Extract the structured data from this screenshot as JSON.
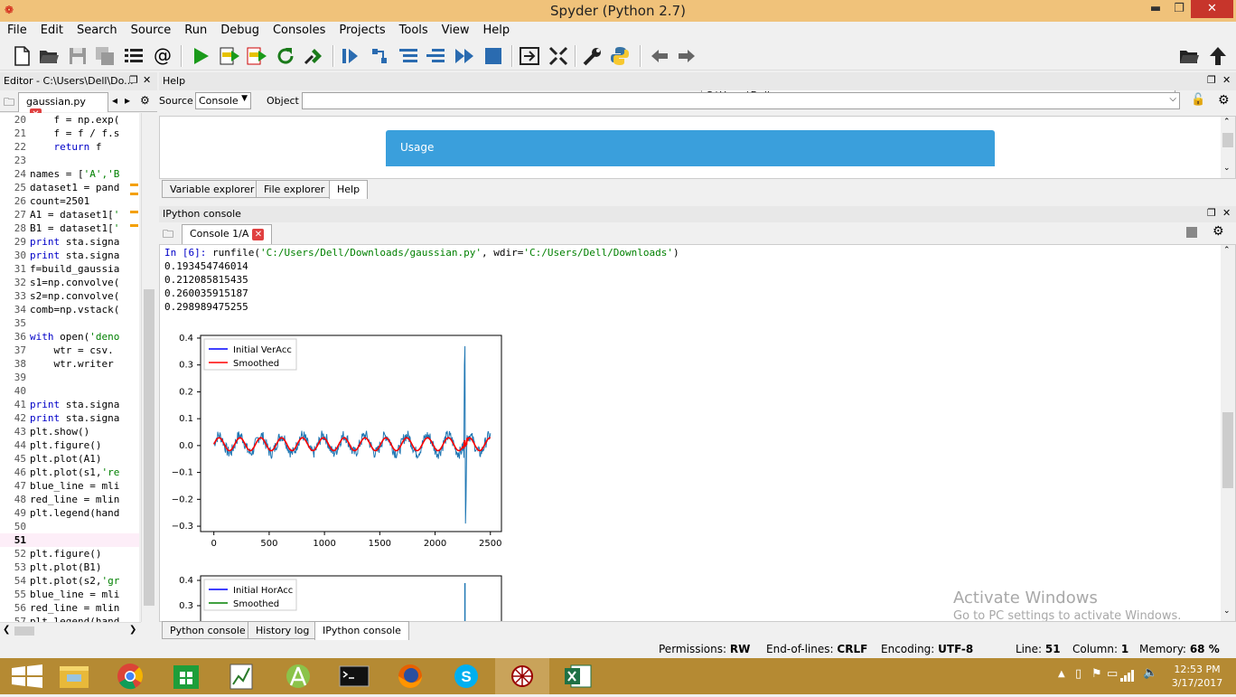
{
  "window": {
    "title": "Spyder (Python 2.7)",
    "min": "▬",
    "max": "❐",
    "close": "✕"
  },
  "menu": [
    "File",
    "Edit",
    "Search",
    "Source",
    "Run",
    "Debug",
    "Consoles",
    "Projects",
    "Tools",
    "View",
    "Help"
  ],
  "toolbar": {
    "path": "C:\\Users\\Dell"
  },
  "editor": {
    "title": "Editor - C:\\Users\\Dell\\Do...",
    "tab": "gaussian.py",
    "lines": [
      {
        "n": "20",
        "code": "    f = np.exp("
      },
      {
        "n": "21",
        "code": "    f = f / f.s"
      },
      {
        "n": "22",
        "code": "    return f"
      },
      {
        "n": "23",
        "code": ""
      },
      {
        "n": "24",
        "code": "names = ['A','B"
      },
      {
        "n": "25",
        "code": "dataset1 = pand"
      },
      {
        "n": "26",
        "code": "count=2501"
      },
      {
        "n": "27",
        "code": "A1 = dataset1['"
      },
      {
        "n": "28",
        "code": "B1 = dataset1['"
      },
      {
        "n": "29",
        "code": "print sta.signa"
      },
      {
        "n": "30",
        "code": "print sta.signa"
      },
      {
        "n": "31",
        "code": "f=build_gaussia"
      },
      {
        "n": "32",
        "code": "s1=np.convolve("
      },
      {
        "n": "33",
        "code": "s2=np.convolve("
      },
      {
        "n": "34",
        "code": "comb=np.vstack("
      },
      {
        "n": "35",
        "code": ""
      },
      {
        "n": "36",
        "code": "with open('deno"
      },
      {
        "n": "37",
        "code": "    wtr = csv."
      },
      {
        "n": "38",
        "code": "    wtr.writer"
      },
      {
        "n": "39",
        "code": ""
      },
      {
        "n": "40",
        "code": ""
      },
      {
        "n": "41",
        "code": "print sta.signa"
      },
      {
        "n": "42",
        "code": "print sta.signa"
      },
      {
        "n": "43",
        "code": "plt.show()"
      },
      {
        "n": "44",
        "code": "plt.figure()"
      },
      {
        "n": "45",
        "code": "plt.plot(A1)"
      },
      {
        "n": "46",
        "code": "plt.plot(s1,'re"
      },
      {
        "n": "47",
        "code": "blue_line = mli"
      },
      {
        "n": "48",
        "code": "red_line = mlin"
      },
      {
        "n": "49",
        "code": "plt.legend(hand"
      },
      {
        "n": "50",
        "code": ""
      },
      {
        "n": "51",
        "code": ""
      },
      {
        "n": "52",
        "code": "plt.figure()"
      },
      {
        "n": "53",
        "code": "plt.plot(B1)"
      },
      {
        "n": "54",
        "code": "plt.plot(s2,'gr"
      },
      {
        "n": "55",
        "code": "blue_line = mli"
      },
      {
        "n": "56",
        "code": "red_line = mlin"
      },
      {
        "n": "57",
        "code": "plt.legend(hand"
      }
    ]
  },
  "help": {
    "title": "Help",
    "source_label": "Source",
    "source_value": "Console",
    "object_label": "Object",
    "usage": "Usage",
    "tabs": [
      "Variable explorer",
      "File explorer",
      "Help"
    ]
  },
  "console": {
    "title": "IPython console",
    "tab": "Console 1/A",
    "prompt": "In [6]: ",
    "cmd_pre": "runfile(",
    "arg1": "'C:/Users/Dell/Downloads/gaussian.py'",
    "cmd_mid": ", wdir=",
    "arg2": "'C:/Users/Dell/Downloads'",
    "cmd_post": ")",
    "outputs": [
      "0.193454746014",
      "0.212085815435",
      "0.260035915187",
      "0.298989475255"
    ],
    "bottom_tabs": [
      "Python console",
      "History log",
      "IPython console"
    ]
  },
  "chart_data": [
    {
      "type": "line",
      "x_ticks": [
        "0",
        "500",
        "1000",
        "1500",
        "2000",
        "2500"
      ],
      "y_ticks": [
        "0.4",
        "0.3",
        "0.2",
        "0.1",
        "0.0",
        "−0.1",
        "−0.2",
        "−0.3"
      ],
      "xlim": [
        -120,
        2600
      ],
      "ylim": [
        -0.32,
        0.41
      ],
      "legend_placement": "top-left",
      "series": [
        {
          "name": "Initial VerAcc",
          "color": "#1f77b4",
          "legend_color": "#0000ff",
          "x_range": [
            0,
            2500
          ],
          "style": "noisy sinusoid ~0.04 amplitude, period ~190, spike to 0.37 and −0.29 near x=2270"
        },
        {
          "name": "Smoothed",
          "color": "#ff0000",
          "legend_color": "#ff0000",
          "x_range": [
            0,
            2500
          ],
          "style": "smoothed sinusoid ~0.025 amplitude"
        }
      ]
    },
    {
      "type": "line",
      "y_ticks": [
        "0.4",
        "0.3"
      ],
      "legend_placement": "top-left",
      "series": [
        {
          "name": "Initial HorAcc",
          "legend_color": "#0000ff"
        },
        {
          "name": "Smoothed",
          "legend_color": "#008000"
        }
      ]
    }
  ],
  "watermark": {
    "line1": "Activate Windows",
    "line2": "Go to PC settings to activate Windows."
  },
  "status": {
    "perm_label": "Permissions:",
    "perm": "RW",
    "eol_label": "End-of-lines:",
    "eol": "CRLF",
    "enc_label": "Encoding:",
    "enc": "UTF-8",
    "line_label": "Line:",
    "line": "51",
    "col_label": "Column:",
    "col": "1",
    "mem_label": "Memory:",
    "mem": "68 %"
  },
  "clock": {
    "time": "12:53 PM",
    "date": "3/17/2017"
  }
}
